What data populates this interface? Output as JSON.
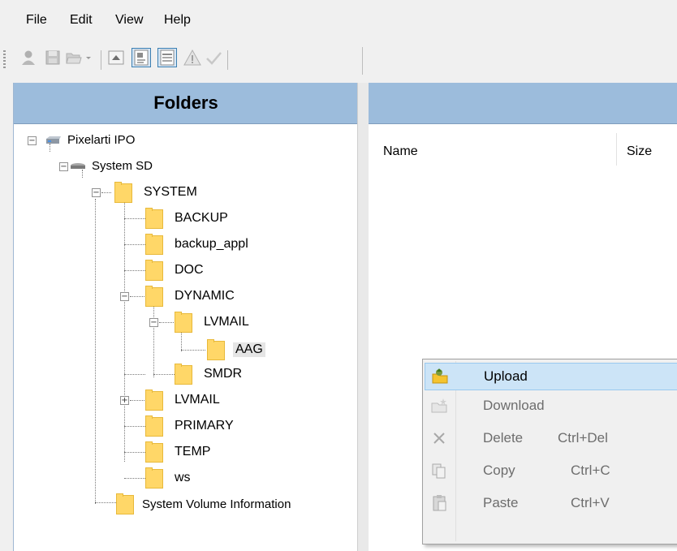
{
  "menubar": {
    "items": [
      "File",
      "Edit",
      "View",
      "Help"
    ]
  },
  "toolbar": {
    "buttons": [
      {
        "icon": "user-icon",
        "enabled": false
      },
      {
        "icon": "save-icon",
        "enabled": false
      },
      {
        "icon": "open-folder-icon",
        "enabled": false
      },
      {
        "icon": "dropdown-arrow-icon",
        "enabled": false
      },
      {
        "icon": "move-up-icon",
        "enabled": true
      },
      {
        "icon": "large-icons-view-icon",
        "enabled": true,
        "pressed": true
      },
      {
        "icon": "details-view-icon",
        "enabled": true,
        "pressed": true
      },
      {
        "icon": "warning-icon",
        "enabled": false
      },
      {
        "icon": "check-icon",
        "enabled": false
      }
    ]
  },
  "folders_panel": {
    "title": "Folders"
  },
  "tree": {
    "root": "Pixelarti IPO",
    "drive": "System SD",
    "system": "SYSTEM",
    "backup": "BACKUP",
    "backup_appl": "backup_appl",
    "doc": "DOC",
    "dynamic": "DYNAMIC",
    "lvmail_inner": "LVMAIL",
    "aag": "AAG",
    "smdr": "SMDR",
    "lvmail": "LVMAIL",
    "primary": "PRIMARY",
    "temp": "TEMP",
    "ws": "ws",
    "svi": "System Volume Information"
  },
  "file_list": {
    "columns": [
      "Name",
      "Size"
    ]
  },
  "context_menu": {
    "items": [
      {
        "label": "Upload",
        "shortcut": "",
        "enabled": true,
        "highlighted": true,
        "icon": "upload-icon"
      },
      {
        "label": "Download",
        "shortcut": "",
        "enabled": false,
        "icon": "download-icon"
      },
      {
        "label": "Delete",
        "shortcut": "Ctrl+Del",
        "enabled": false,
        "icon": "delete-icon"
      },
      {
        "label": "Copy",
        "shortcut": "Ctrl+C",
        "enabled": false,
        "icon": "copy-icon"
      },
      {
        "label": "Paste",
        "shortcut": "Ctrl+V",
        "enabled": false,
        "icon": "paste-icon"
      }
    ]
  },
  "colors": {
    "header_blue": "#9cbcdc",
    "folder_yellow": "#ffd768",
    "menu_highlight": "#cce4f7"
  }
}
